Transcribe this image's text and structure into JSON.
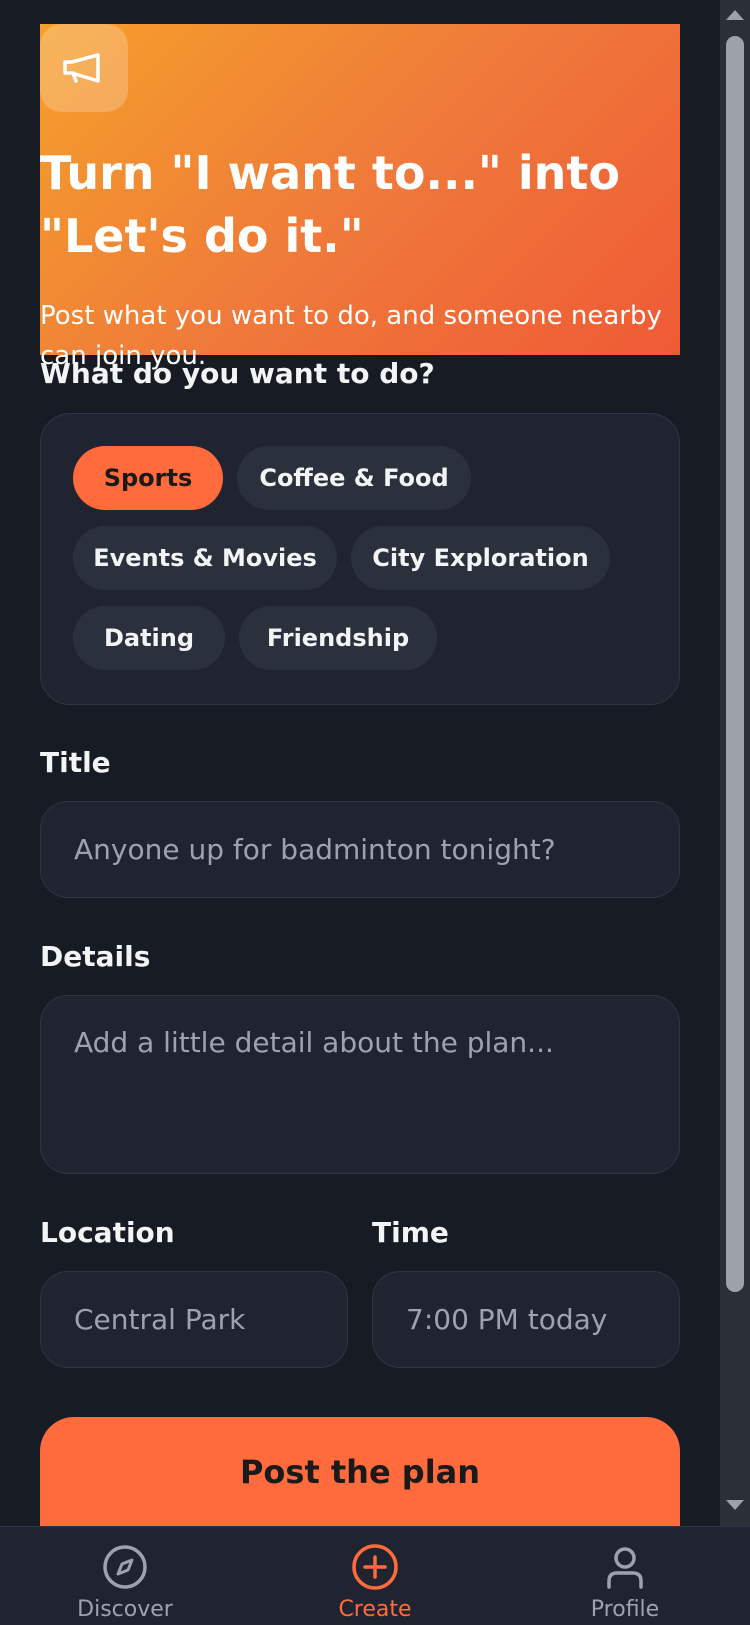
{
  "hero": {
    "icon": "megaphone-icon",
    "title": "Turn \"I want to...\" into \"Let's do it.\"",
    "subtitle": "Post what you want to do, and someone nearby can join you."
  },
  "form": {
    "category_label": "What do you want to do?",
    "categories": [
      {
        "label": "Sports",
        "selected": true
      },
      {
        "label": "Coffee & Food",
        "selected": false
      },
      {
        "label": "Events & Movies",
        "selected": false
      },
      {
        "label": "City Exploration",
        "selected": false
      },
      {
        "label": "Dating",
        "selected": false
      },
      {
        "label": "Friendship",
        "selected": false
      }
    ],
    "title_label": "Title",
    "title_placeholder": "Anyone up for badminton tonight?",
    "details_label": "Details",
    "details_placeholder": "Add a little detail about the plan...",
    "location_label": "Location",
    "location_placeholder": "Central Park",
    "time_label": "Time",
    "time_placeholder": "7:00 PM today",
    "submit_label": "Post the plan"
  },
  "nav": {
    "items": [
      {
        "label": "Discover",
        "icon": "compass-icon",
        "active": false
      },
      {
        "label": "Create",
        "icon": "plus-circle-icon",
        "active": true
      },
      {
        "label": "Profile",
        "icon": "user-icon",
        "active": false
      }
    ]
  },
  "colors": {
    "background": "#171b24",
    "surface": "#1f2430",
    "accent": "#ff6b3d",
    "hero_gradient_start": "#f5a02a",
    "hero_gradient_end": "#ef5a36"
  }
}
